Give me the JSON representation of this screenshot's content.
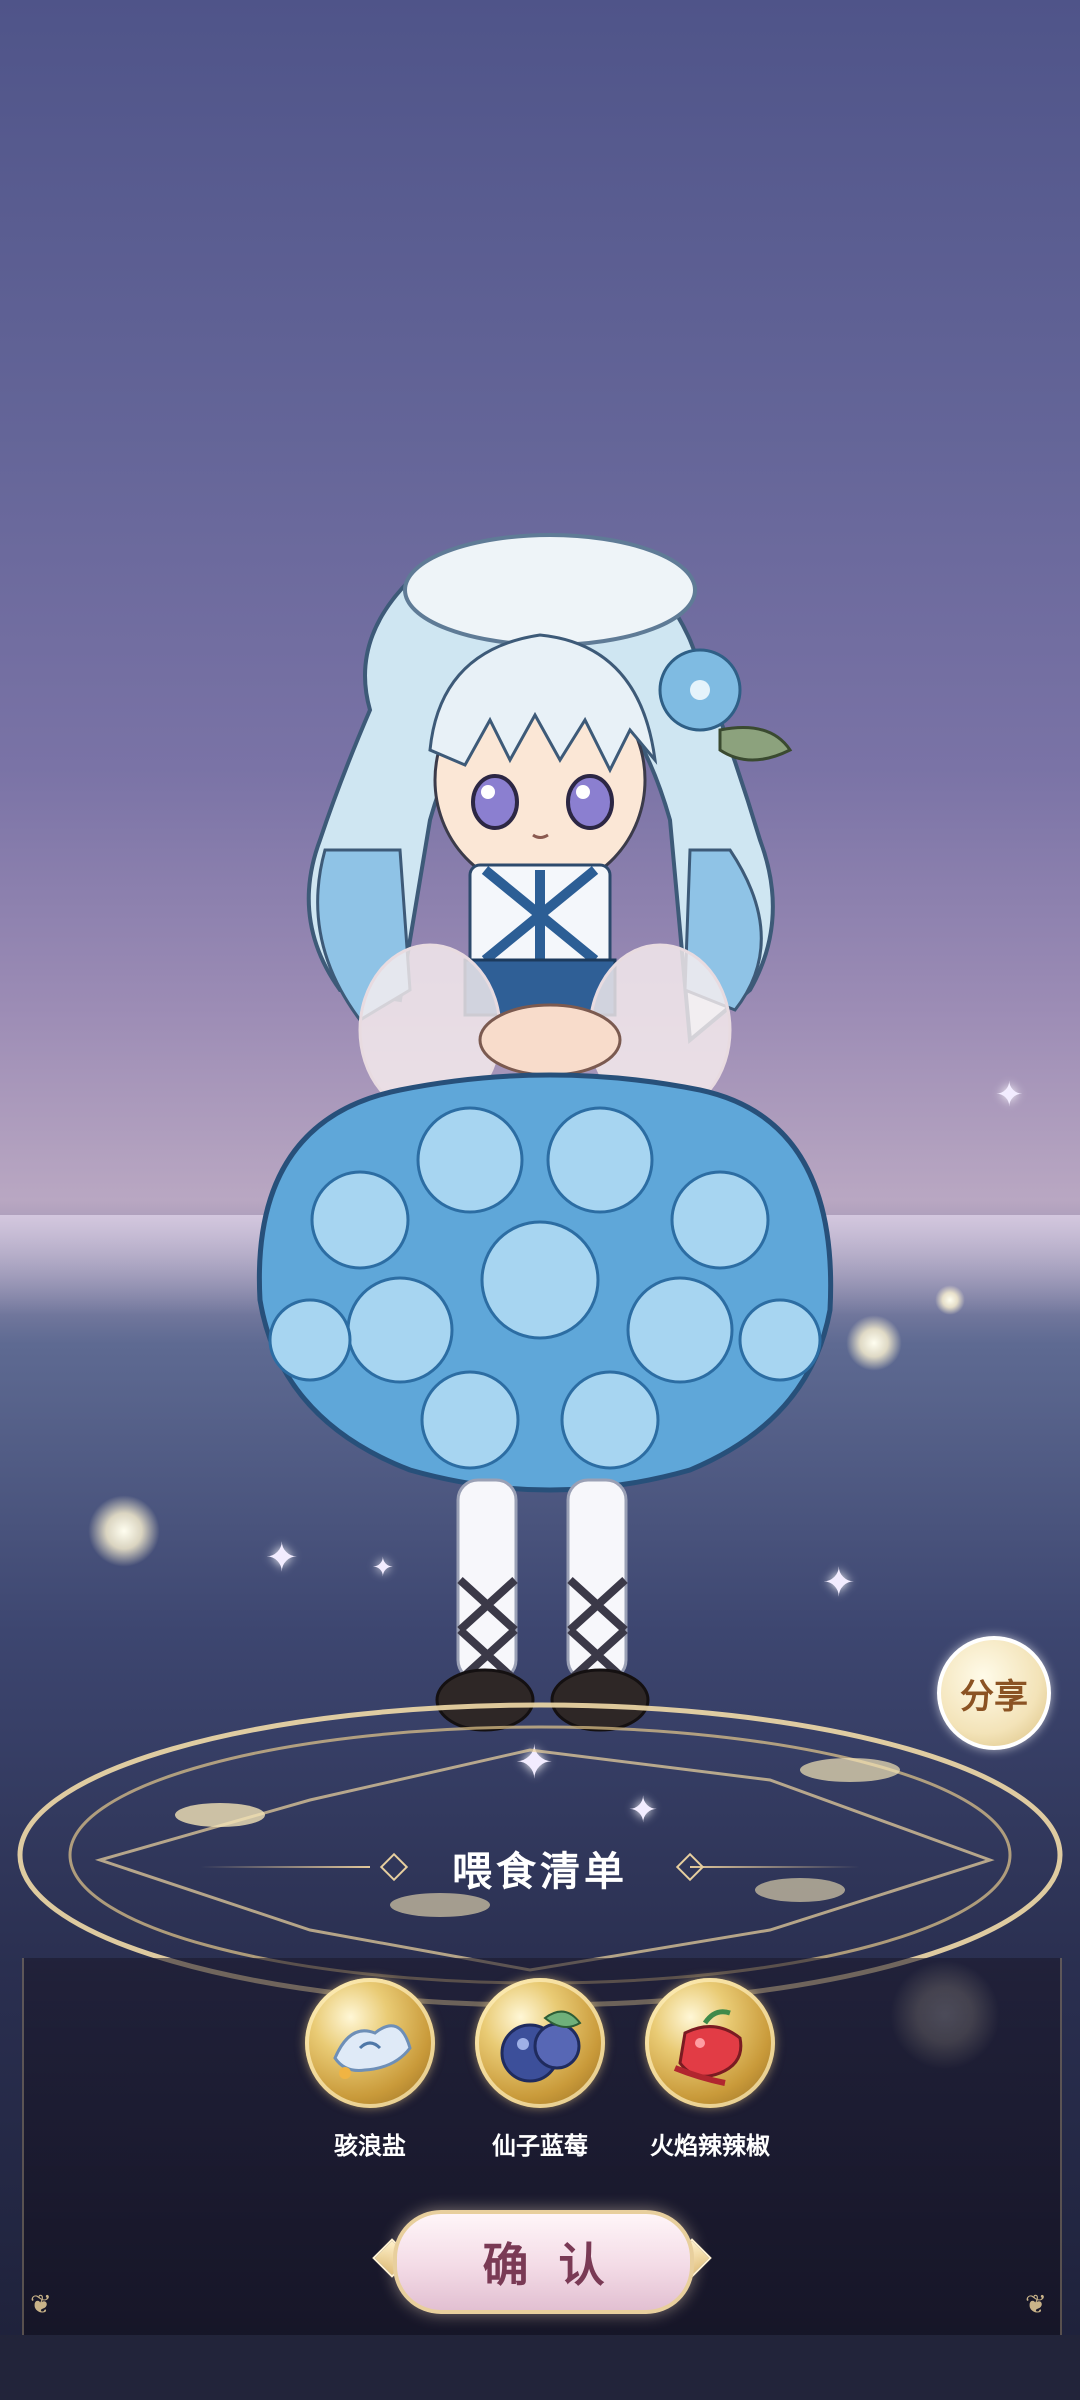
{
  "share": {
    "label": "分享"
  },
  "feeding_list": {
    "title": "喂食清单",
    "items": [
      {
        "label": "骇浪盐",
        "icon": "salt-icon"
      },
      {
        "label": "仙子蓝莓",
        "icon": "blueberry-icon"
      },
      {
        "label": "火焰辣辣椒",
        "icon": "chili-pepper-icon"
      }
    ]
  },
  "confirm": {
    "label": "确认"
  },
  "colors": {
    "panel_gold": "#e2c89a",
    "confirm_text": "#7a3a55",
    "share_text": "#8b5323"
  }
}
